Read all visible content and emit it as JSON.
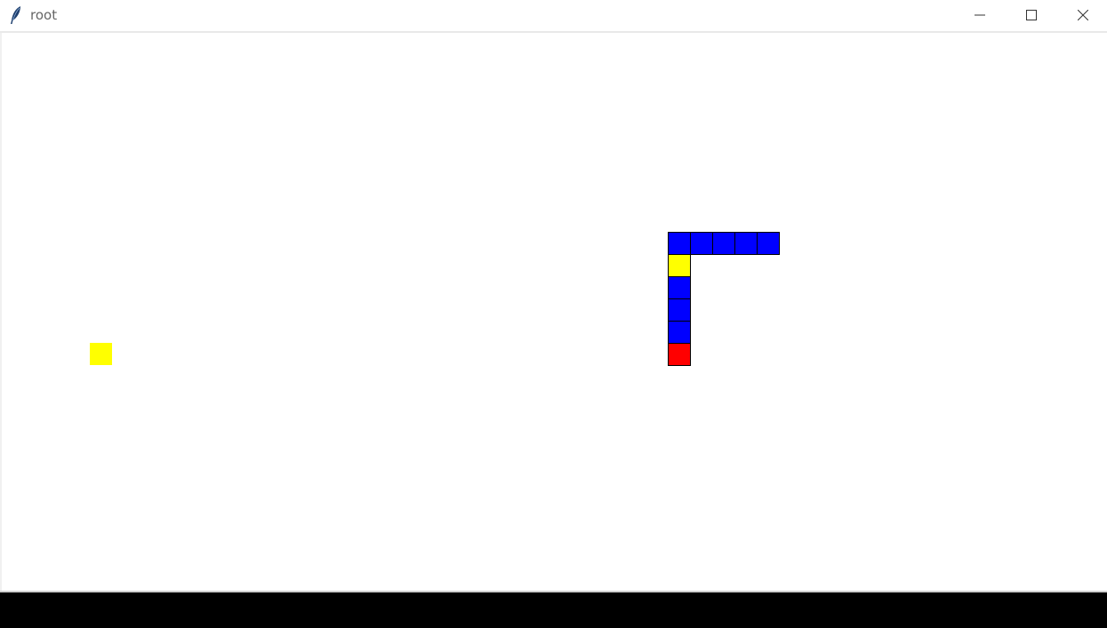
{
  "window": {
    "title": "root",
    "icon": "feather-icon",
    "controls": [
      "minimize-icon",
      "maximize-icon",
      "close-icon"
    ]
  },
  "game": {
    "cell_size": 25,
    "colors": {
      "snake_body": "#0000ff",
      "snake_head": "#ff0000",
      "food": "#ffff00",
      "outline": "#000000",
      "background": "#ffffff"
    },
    "snake": [
      {
        "col": 30,
        "row": 14,
        "kind": "head"
      },
      {
        "col": 30,
        "row": 13,
        "kind": "body"
      },
      {
        "col": 30,
        "row": 12,
        "kind": "body"
      },
      {
        "col": 30,
        "row": 11,
        "kind": "body"
      },
      {
        "col": 30,
        "row": 10,
        "kind": "food-inside"
      },
      {
        "col": 30,
        "row": 9,
        "kind": "body"
      },
      {
        "col": 31,
        "row": 9,
        "kind": "body"
      },
      {
        "col": 32,
        "row": 9,
        "kind": "body"
      },
      {
        "col": 33,
        "row": 9,
        "kind": "body"
      },
      {
        "col": 34,
        "row": 9,
        "kind": "body"
      }
    ],
    "food": {
      "col": 4,
      "row": 14
    }
  }
}
